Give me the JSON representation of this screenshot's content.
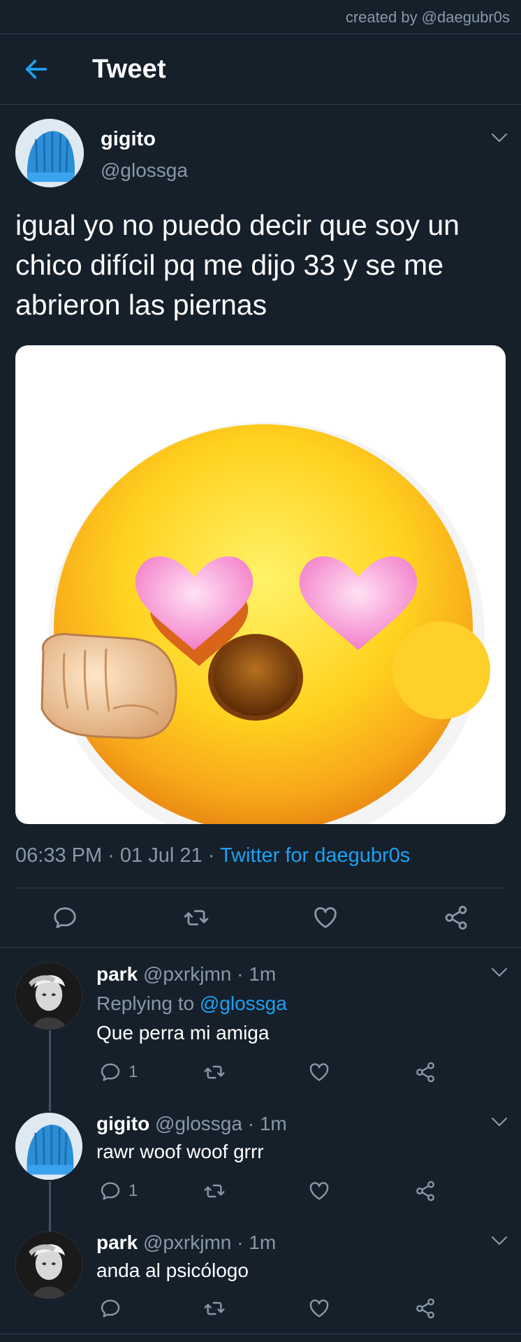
{
  "credit": "created by @daegubr0s",
  "header": {
    "title": "Tweet",
    "back_icon": "arrow-left-icon"
  },
  "tweet": {
    "name": "gigito",
    "handle": "@glossga",
    "text": "igual yo no puedo decir que soy un chico difícil pq me dijo 33 y se me abrieron las piernas",
    "time": "06:33 PM",
    "date": "01 Jul 21",
    "source": "Twitter for daegubr0s"
  },
  "replies": [
    {
      "name": "park",
      "handle": "@pxrkjmn",
      "time": "1m",
      "replying_prefix": "Replying to ",
      "replying_to": "@glossga",
      "text": "Que perra mi amiga",
      "reply_count": "1"
    },
    {
      "name": "gigito",
      "handle": "@glossga",
      "time": "1m",
      "text": "rawr woof woof grrr",
      "reply_count": "1"
    },
    {
      "name": "park",
      "handle": "@pxrkjmn",
      "time": "1m",
      "text": "anda al psicólogo",
      "reply_count": ""
    }
  ],
  "colors": {
    "background": "#15202b",
    "accent": "#1da1f2",
    "secondary_text": "#8899a6",
    "divider": "#2f3f4f"
  }
}
